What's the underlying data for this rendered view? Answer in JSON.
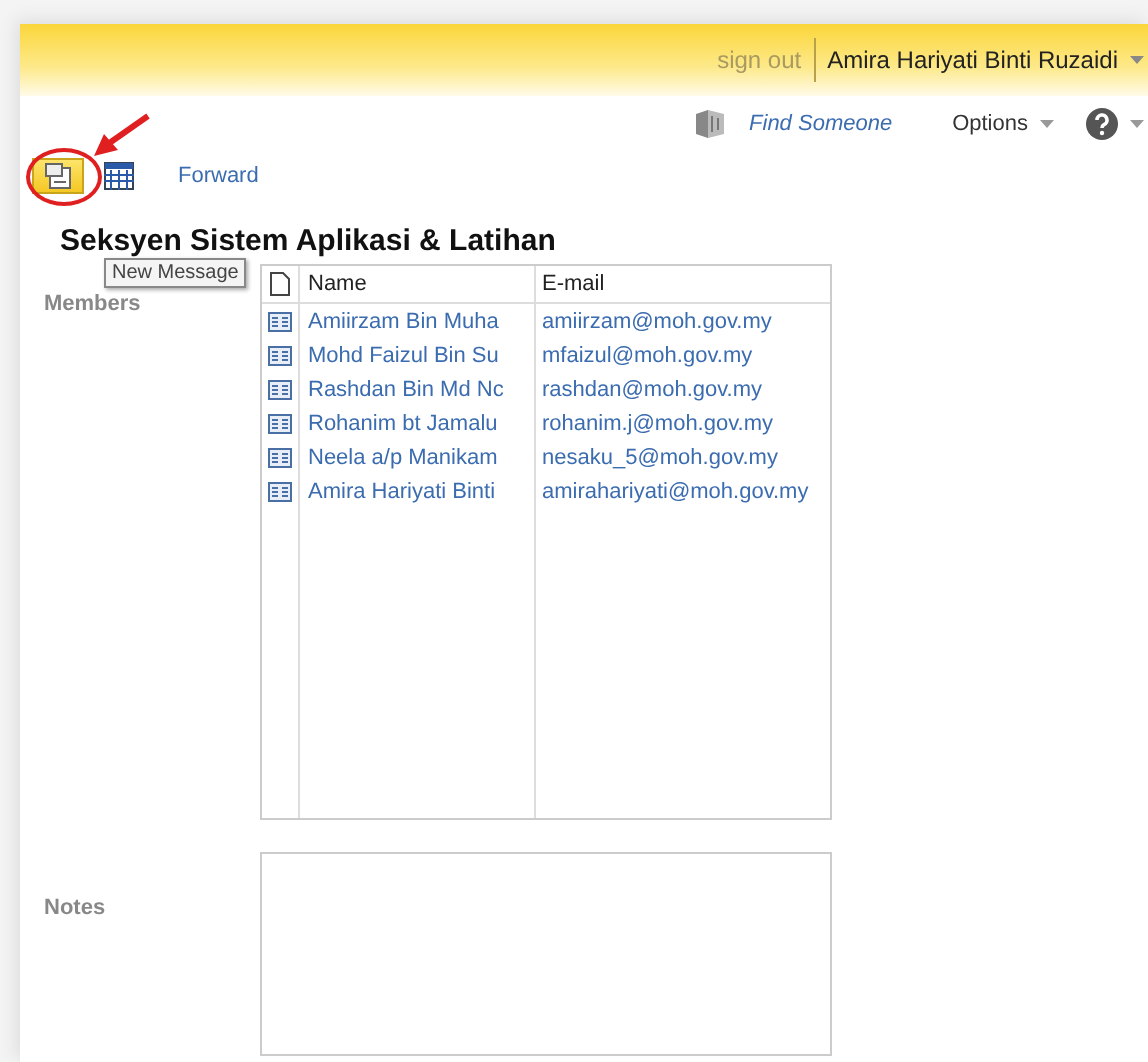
{
  "header": {
    "sign_out": "sign out",
    "user_name": "Amira Hariyati Binti Ruzaidi"
  },
  "toolbar": {
    "find_someone": "Find Someone",
    "options": "Options"
  },
  "actions": {
    "forward": "Forward"
  },
  "tooltip": "New Message",
  "title": "Seksyen Sistem Aplikasi & Latihan",
  "members": {
    "label": "Members",
    "columns": [
      "Name",
      "E-mail"
    ],
    "rows": [
      {
        "name": "Amiirzam Bin Muha",
        "email": "amiirzam@moh.gov.my"
      },
      {
        "name": "Mohd Faizul Bin Su",
        "email": "mfaizul@moh.gov.my"
      },
      {
        "name": "Rashdan Bin Md Nc",
        "email": "rashdan@moh.gov.my"
      },
      {
        "name": "Rohanim bt Jamalu",
        "email": "rohanim.j@moh.gov.my"
      },
      {
        "name": "Neela a/p Manikam",
        "email": "nesaku_5@moh.gov.my"
      },
      {
        "name": "Amira Hariyati Binti",
        "email": "amirahariyati@moh.gov.my"
      }
    ]
  },
  "notes": {
    "label": "Notes"
  }
}
